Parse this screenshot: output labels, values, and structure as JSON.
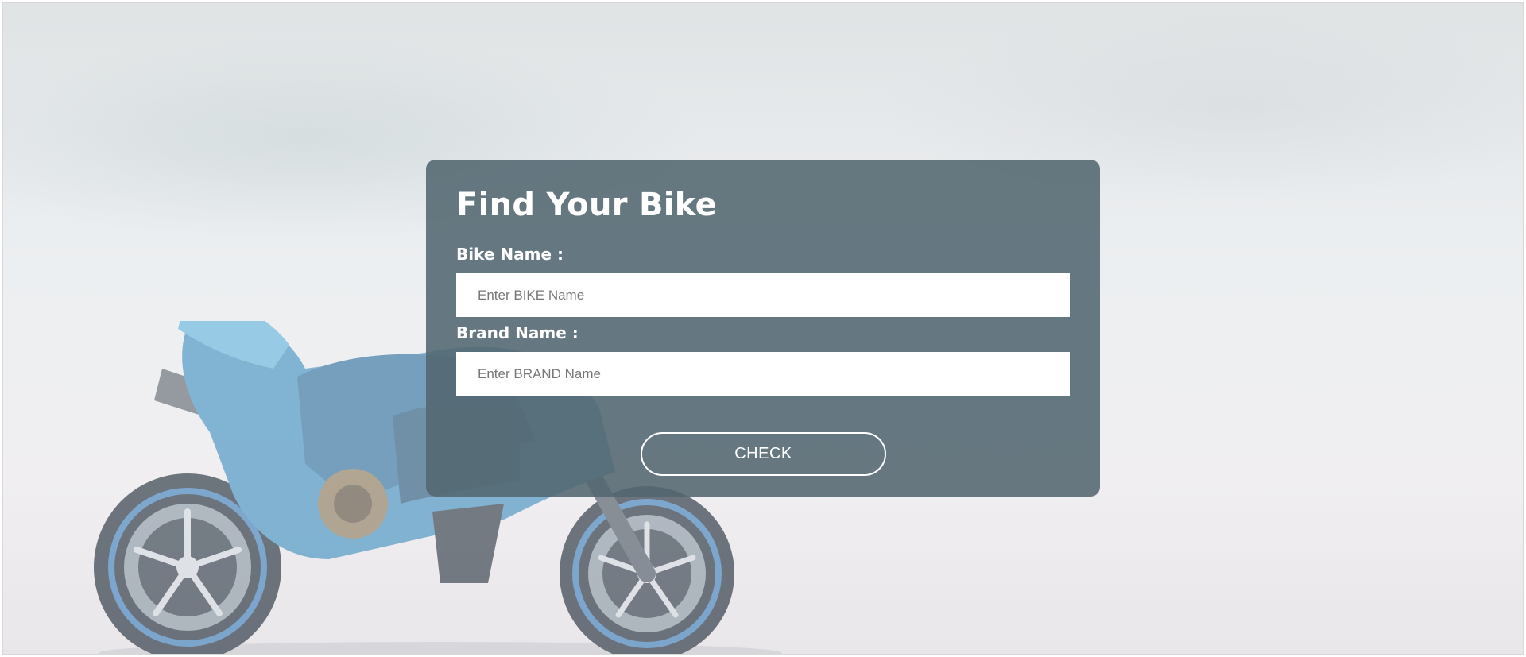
{
  "form": {
    "title": "Find Your Bike",
    "bike_name": {
      "label": "Bike Name :",
      "placeholder": "Enter BIKE Name",
      "value": ""
    },
    "brand_name": {
      "label": "Brand Name :",
      "placeholder": "Enter BRAND Name",
      "value": ""
    },
    "submit_label": "CHECK"
  },
  "background": {
    "image_subject": "blue sport motorcycle",
    "icon": "motorcycle-illustration"
  },
  "colors": {
    "panel": "#526770",
    "panel_text": "#ffffff",
    "input_background": "#ffffff",
    "placeholder": "#777777",
    "bike_accent": "#3f8fc0"
  }
}
